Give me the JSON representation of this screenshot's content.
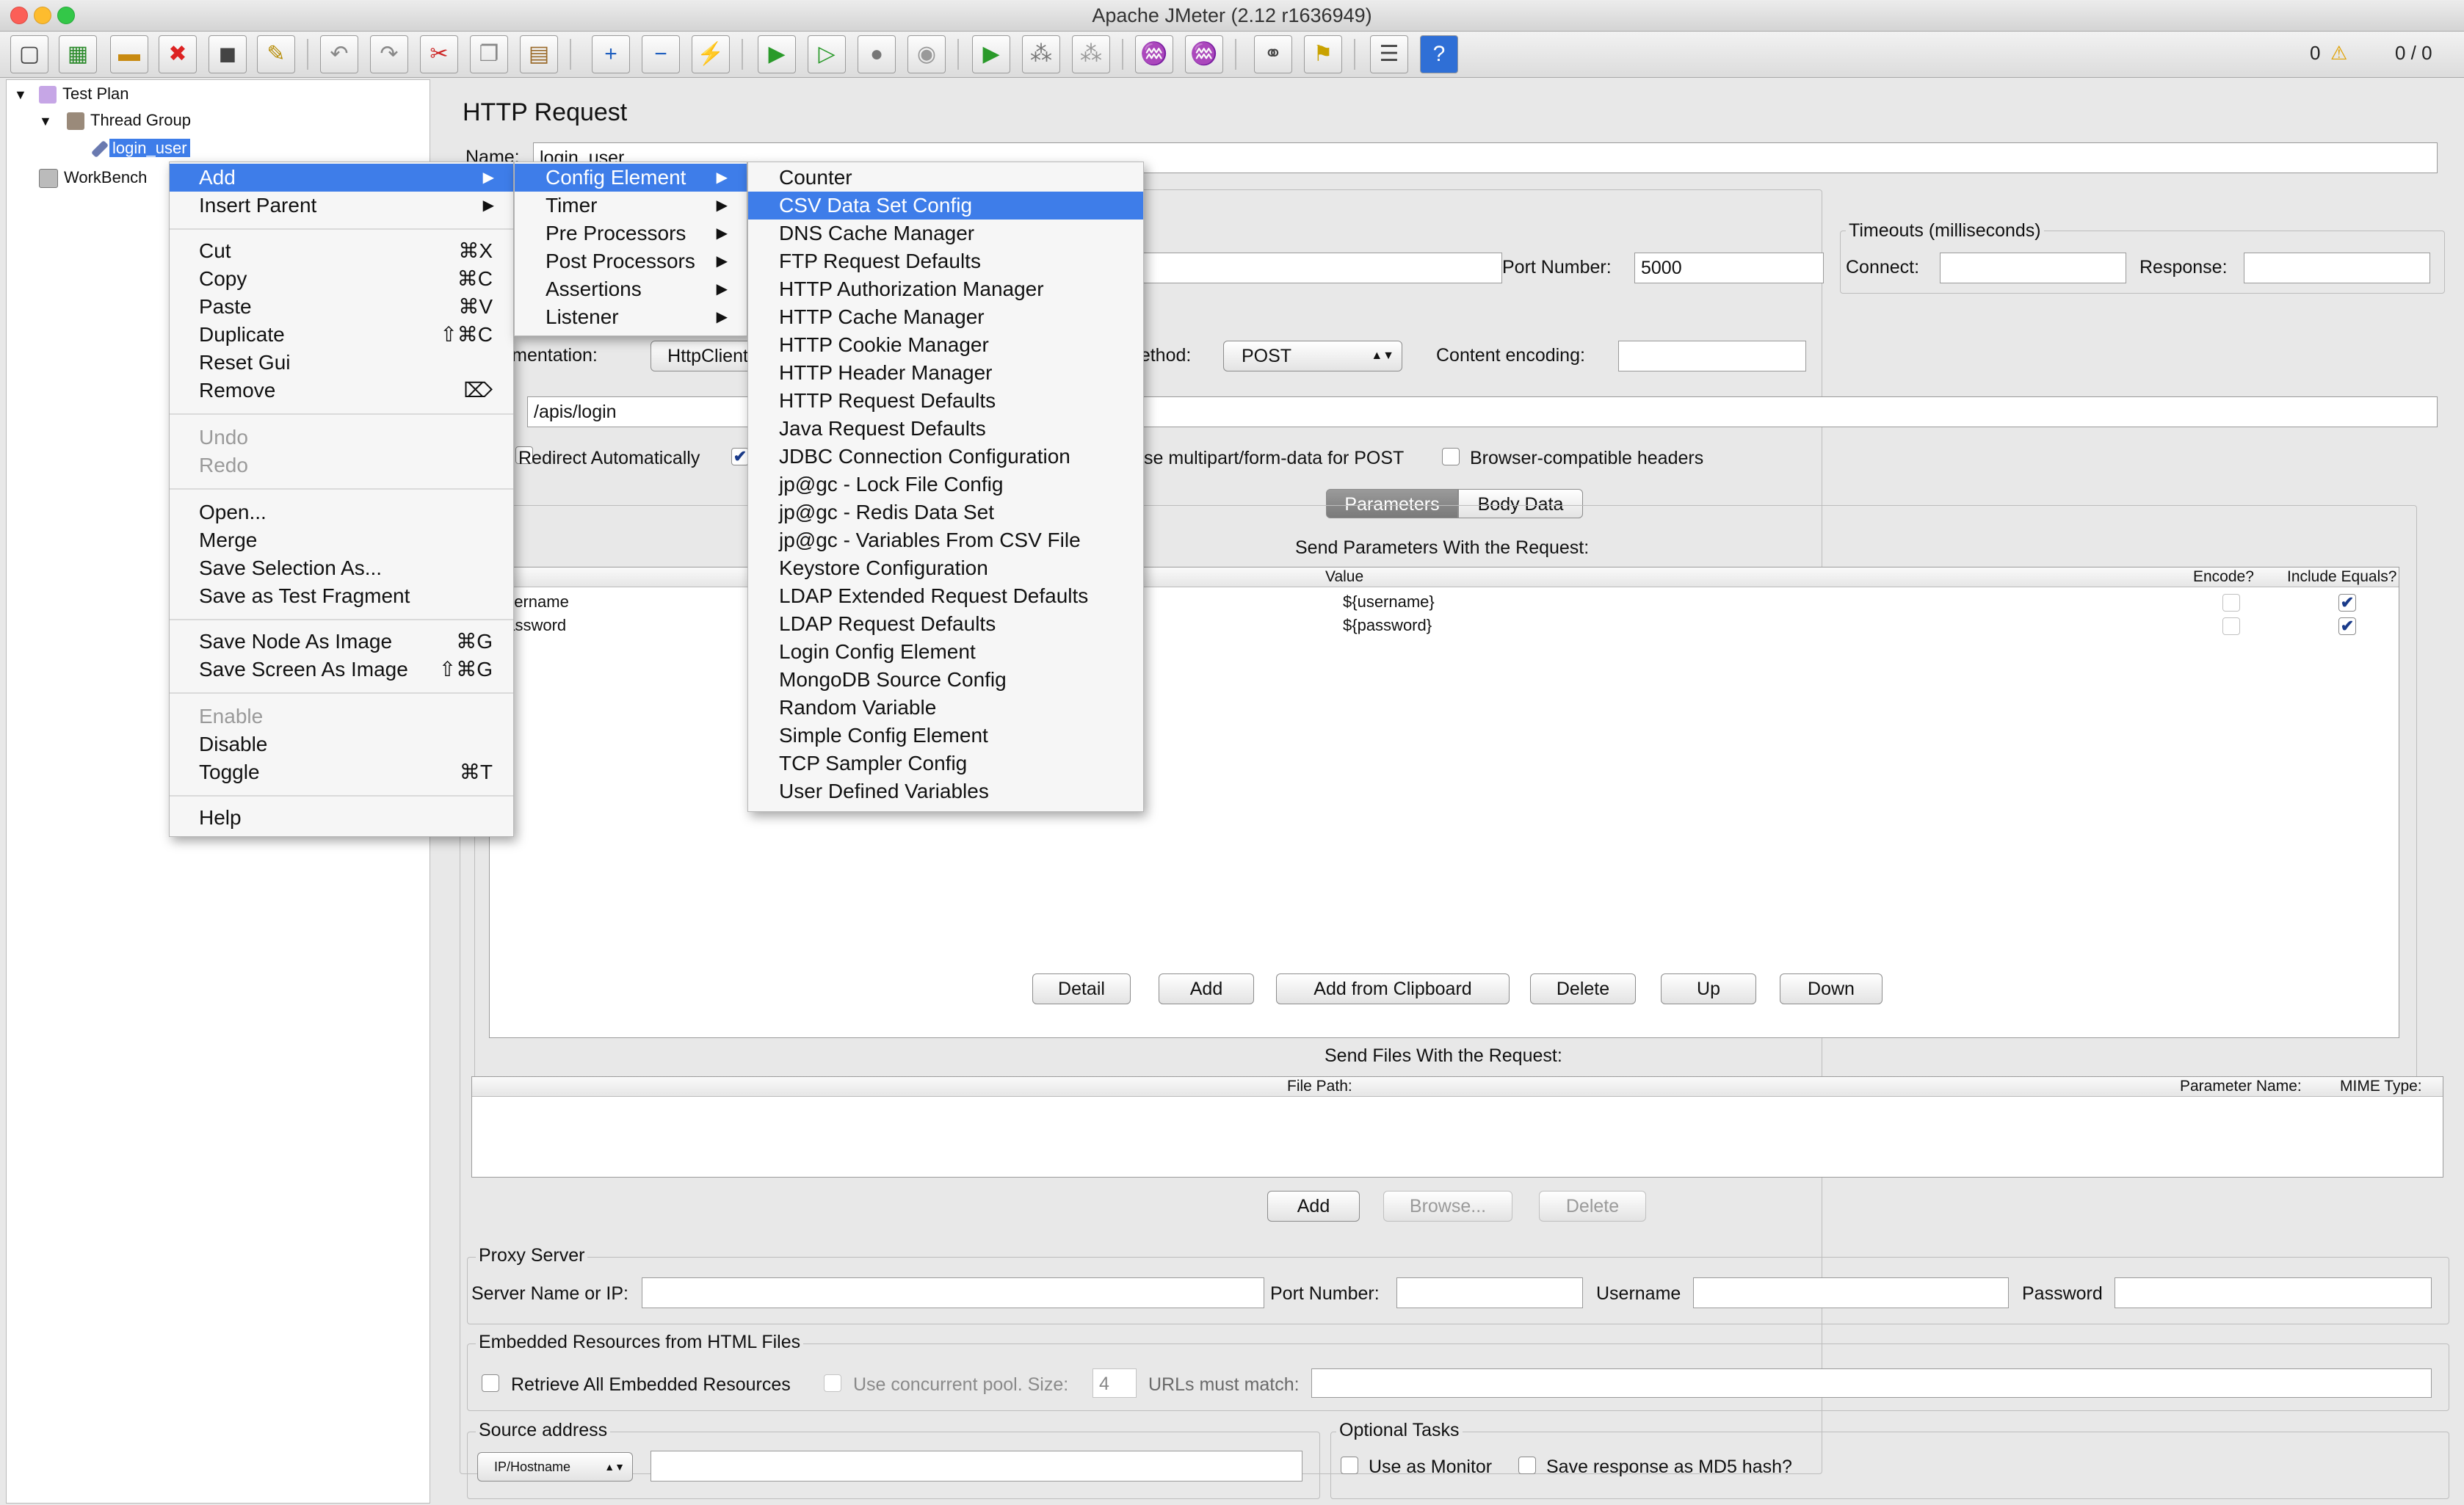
{
  "window": {
    "title": "Apache JMeter (2.12 r1636949)"
  },
  "status": {
    "warnings": "0",
    "threads": "0 / 0"
  },
  "tree": {
    "test_plan": "Test Plan",
    "thread_group": "Thread Group",
    "login_user": "login_user",
    "workbench": "WorkBench"
  },
  "panel": {
    "title": "HTTP Request",
    "name_label": "Name:",
    "name_value": "login_user",
    "port_label": "Port Number:",
    "port_value": "5000",
    "timeouts_title": "Timeouts (milliseconds)",
    "connect_label": "Connect:",
    "response_label": "Response:",
    "implementation_label": "Implementation:",
    "implementation_value": "HttpClient4",
    "method_label": "Method:",
    "method_value": "POST",
    "content_encoding_label": "Content encoding:",
    "path_value": "/apis/login",
    "redirect_auto": "Redirect Automatically",
    "use_multipart": "Use multipart/form-data for POST",
    "browser_headers": "Browser-compatible headers",
    "tab_parameters": "Parameters",
    "tab_body": "Body Data",
    "send_params_title": "Send Parameters With the Request:",
    "col_value": "Value",
    "col_encode": "Encode?",
    "col_include_equals": "Include Equals?",
    "params": [
      {
        "name": "username",
        "value": "${username}"
      },
      {
        "name": "password",
        "value": "${password}"
      }
    ],
    "btn_detail": "Detail",
    "btn_add": "Add",
    "btn_add_clipboard": "Add from Clipboard",
    "btn_delete": "Delete",
    "btn_up": "Up",
    "btn_down": "Down",
    "send_files_title": "Send Files With the Request:",
    "col_file_path": "File Path:",
    "col_param_name": "Parameter Name:",
    "col_mime": "MIME Type:",
    "files_add": "Add",
    "files_browse": "Browse...",
    "files_delete": "Delete",
    "proxy_title": "Proxy Server",
    "proxy_server_label": "Server Name or IP:",
    "proxy_port_label": "Port Number:",
    "proxy_user_label": "Username",
    "proxy_pass_label": "Password",
    "embedded_title": "Embedded Resources from HTML Files",
    "retrieve_all": "Retrieve All Embedded Resources",
    "concurrent_pool": "Use concurrent pool. Size:",
    "pool_size": "4",
    "urls_match": "URLs must match:",
    "source_title": "Source address",
    "source_select": "IP/Hostname",
    "optional_title": "Optional Tasks",
    "use_monitor": "Use as Monitor",
    "save_md5": "Save response as MD5 hash?"
  },
  "context_menu": {
    "add": "Add",
    "insert_parent": "Insert Parent",
    "cut": "Cut",
    "cut_sc": "⌘X",
    "copy": "Copy",
    "copy_sc": "⌘C",
    "paste": "Paste",
    "paste_sc": "⌘V",
    "duplicate": "Duplicate",
    "duplicate_sc": "⇧⌘C",
    "reset_gui": "Reset Gui",
    "remove": "Remove",
    "remove_sc": "⌦",
    "undo": "Undo",
    "redo": "Redo",
    "open": "Open...",
    "merge": "Merge",
    "save_selection": "Save Selection As...",
    "save_fragment": "Save as Test Fragment",
    "save_node_image": "Save Node As Image",
    "save_node_image_sc": "⌘G",
    "save_screen_image": "Save Screen As Image",
    "save_screen_image_sc": "⇧⌘G",
    "enable": "Enable",
    "disable": "Disable",
    "toggle": "Toggle",
    "toggle_sc": "⌘T",
    "help": "Help"
  },
  "add_submenu": [
    "Config Element",
    "Timer",
    "Pre Processors",
    "Post Processors",
    "Assertions",
    "Listener"
  ],
  "config_submenu": [
    "Counter",
    "CSV Data Set Config",
    "DNS Cache Manager",
    "FTP Request Defaults",
    "HTTP Authorization Manager",
    "HTTP Cache Manager",
    "HTTP Cookie Manager",
    "HTTP Header Manager",
    "HTTP Request Defaults",
    "Java Request Defaults",
    "JDBC Connection Configuration",
    "jp@gc - Lock File Config",
    "jp@gc - Redis Data Set",
    "jp@gc - Variables From CSV File",
    "Keystore Configuration",
    "LDAP Extended Request Defaults",
    "LDAP Request Defaults",
    "Login Config Element",
    "MongoDB Source Config",
    "Random Variable",
    "Simple Config Element",
    "TCP Sampler Config",
    "User Defined Variables"
  ],
  "colors": {
    "selection": "#3e7de9",
    "close": "#fc5f57",
    "minimize": "#fdbc2e",
    "zoom": "#33c748"
  }
}
